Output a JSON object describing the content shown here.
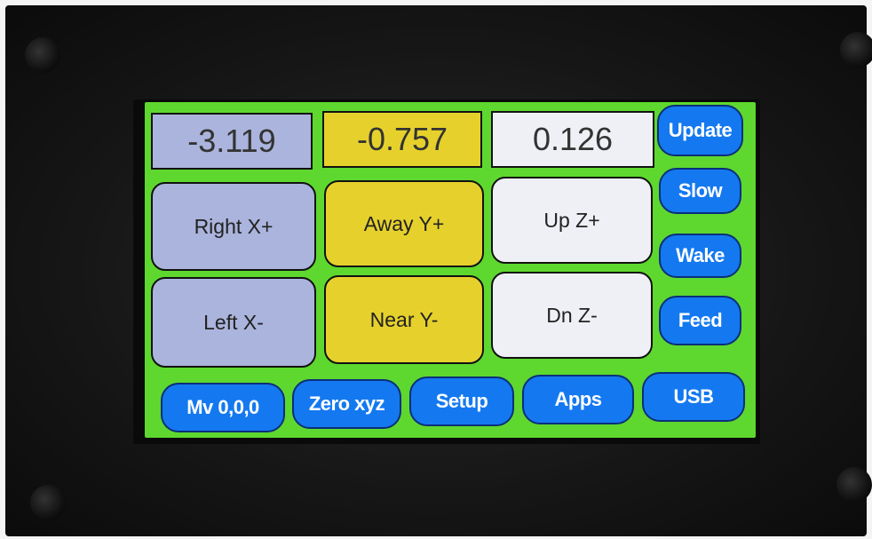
{
  "readouts": {
    "x": "-3.119",
    "y": "-0.757",
    "z": "0.126"
  },
  "jog": {
    "x_plus": "Right X+",
    "y_plus": "Away Y+",
    "z_plus": "Up Z+",
    "x_minus": "Left X-",
    "y_minus": "Near Y-",
    "z_minus": "Dn Z-"
  },
  "side_buttons": {
    "update": "Update",
    "slow": "Slow",
    "wake": "Wake",
    "feed": "Feed"
  },
  "bottom_buttons": {
    "move_origin": "Mv 0,0,0",
    "zero_xyz": "Zero xyz",
    "setup": "Setup",
    "apps": "Apps",
    "usb": "USB"
  },
  "colors": {
    "background": "#5ed82e",
    "x_axis": "#aab4dc",
    "y_axis": "#e6d12c",
    "z_axis": "#eef0f6",
    "button": "#1479f0"
  }
}
